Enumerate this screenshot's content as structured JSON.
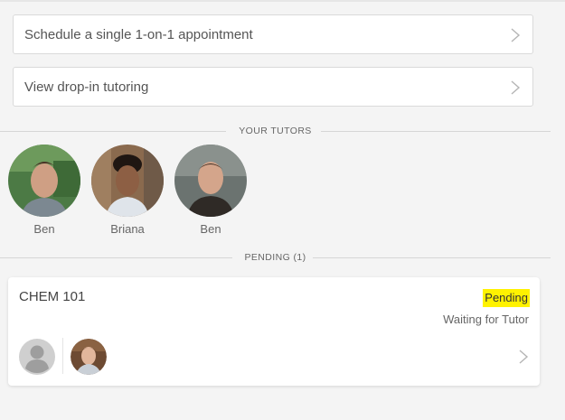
{
  "actions": [
    {
      "label": "Schedule a single 1-on-1 appointment"
    },
    {
      "label": "View drop-in tutoring"
    }
  ],
  "tutors_section": {
    "header": "YOUR TUTORS",
    "tutors": [
      {
        "name": "Ben"
      },
      {
        "name": "Briana"
      },
      {
        "name": "Ben"
      }
    ]
  },
  "pending_section": {
    "header": "PENDING (1)",
    "items": [
      {
        "course": "CHEM 101",
        "status": "Pending",
        "status_detail": "Waiting for Tutor"
      }
    ]
  },
  "colors": {
    "highlight": "#fff200",
    "card_border": "#dadada",
    "background": "#f4f4f4"
  },
  "icons": [
    "chevron-right-icon",
    "default-user-icon"
  ]
}
